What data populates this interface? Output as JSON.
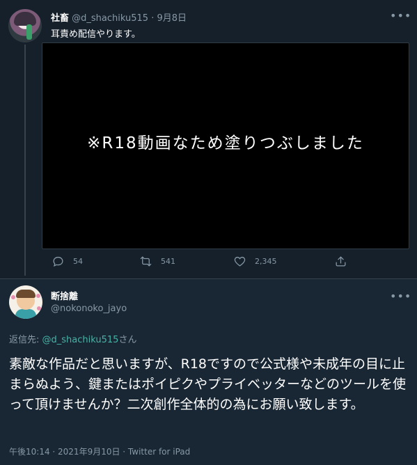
{
  "colors": {
    "background": "#15202b",
    "focused_background": "#192734",
    "secondary_text": "#8899a6",
    "divider": "#38444d",
    "mention": "#45b4a6"
  },
  "tweet1": {
    "display_name": "社畜",
    "handle": "@d_shachiku515",
    "separator": " · ",
    "date": "9月8日",
    "text": "耳責め配信やります。",
    "media_overlay": "※R18動画なため塗りつぶしました",
    "more_icon": "more-horizontal-icon",
    "actions": {
      "reply_count": "54",
      "retweet_count": "541",
      "like_count": "2,345"
    }
  },
  "tweet2": {
    "display_name": "断捨離",
    "handle": "@nokonoko_jayo",
    "reply_prefix": "返信先: ",
    "reply_mention": "@d_shachiku515",
    "reply_suffix": "さん",
    "body": "素敵な作品だと思いますが、R18ですので公式様や未成年の目に止まらぬよう、鍵またはポイピクやプライベッターなどのツールを使って頂けませんか？二次創作全体的の為にお願い致します。",
    "footer": "午後10:14 · 2021年9月10日 · Twitter for iPad",
    "more_icon": "more-horizontal-icon"
  }
}
